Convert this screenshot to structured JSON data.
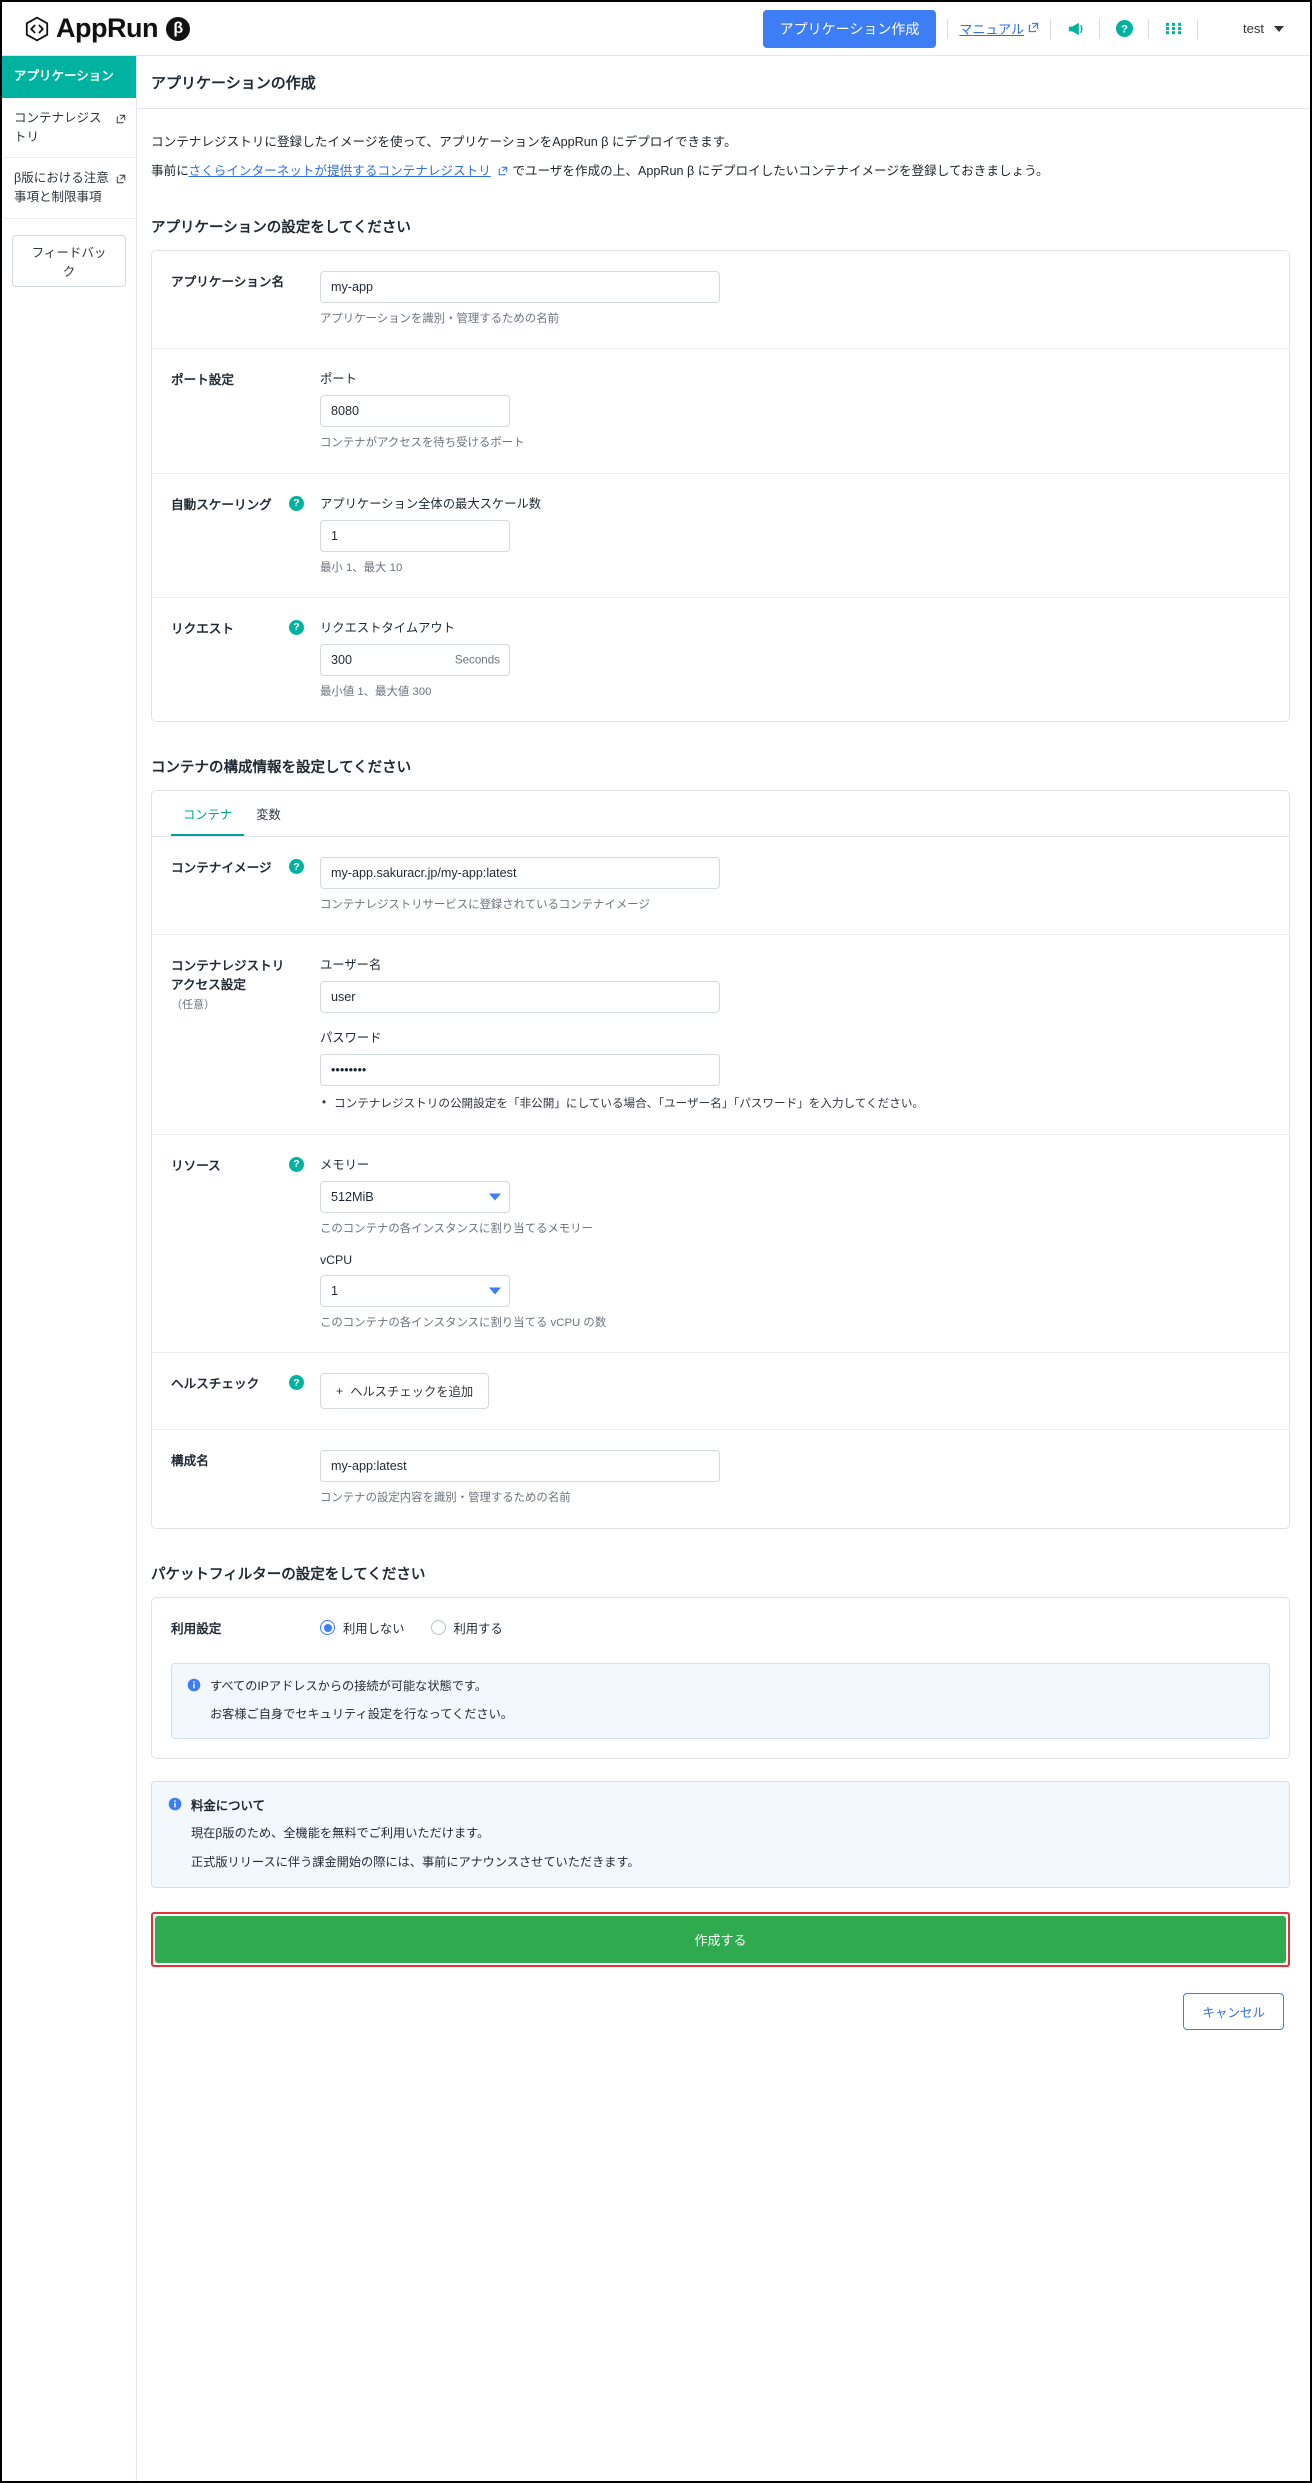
{
  "header": {
    "brand": "AppRun",
    "brand_beta": "β",
    "create_app_button": "アプリケーション作成",
    "manual_link": "マニュアル",
    "announce_icon": "megaphone-icon",
    "help_icon": "help-icon",
    "apps_icon": "grid-apps-icon",
    "user": "test"
  },
  "sidebar": {
    "items": [
      {
        "label": "アプリケーション",
        "active": true,
        "external": false
      },
      {
        "label": "コンテナレジストリ",
        "active": false,
        "external": true
      },
      {
        "label": "β版における注意事項と制限事項",
        "active": false,
        "external": true
      }
    ],
    "feedback_button": "フィードバック"
  },
  "page": {
    "title": "アプリケーションの作成",
    "intro_line1": "コンテナレジストリに登録したイメージを使って、アプリケーションをAppRun β にデプロイできます。",
    "intro_line2_pre": "事前に",
    "intro_line2_link": "さくらインターネットが提供するコンテナレジストリ",
    "intro_line2_post": "でユーザを作成の上、AppRun β にデプロイしたいコンテナイメージを登録しておきましょう。"
  },
  "app_section": {
    "heading": "アプリケーションの設定をしてください",
    "app_name": {
      "label": "アプリケーション名",
      "value": "my-app",
      "hint": "アプリケーションを識別・管理するための名前"
    },
    "port": {
      "label": "ポート設定",
      "sublabel": "ポート",
      "value": "8080",
      "hint": "コンテナがアクセスを待ち受けるポート"
    },
    "autoscale": {
      "label": "自動スケーリング",
      "sublabel": "アプリケーション全体の最大スケール数",
      "value": "1",
      "hint": "最小 1、最大 10",
      "help_icon": "help-icon"
    },
    "request": {
      "label": "リクエスト",
      "sublabel": "リクエストタイムアウト",
      "value": "300",
      "suffix": "Seconds",
      "hint": "最小値 1、最大値 300",
      "help_icon": "help-icon"
    }
  },
  "container_section": {
    "heading": "コンテナの構成情報を設定してください",
    "tabs": [
      {
        "label": "コンテナ",
        "active": true
      },
      {
        "label": "変数",
        "active": false
      }
    ],
    "image": {
      "label": "コンテナイメージ",
      "value": "my-app.sakuracr.jp/my-app:latest",
      "hint": "コンテナレジストリサービスに登録されているコンテナイメージ",
      "help_icon": "help-icon"
    },
    "registry_access": {
      "label": "コンテナレジストリアクセス設定",
      "label_optional": "（任意）",
      "username_label": "ユーザー名",
      "username_value": "user",
      "password_label": "パスワード",
      "password_value": "••••••••",
      "bullet": "コンテナレジストリの公開設定を「非公開」にしている場合、「ユーザー名」「パスワード」を入力してください。"
    },
    "resource": {
      "label": "リソース",
      "memory_label": "メモリー",
      "memory_value": "512MiB",
      "memory_hint": "このコンテナの各インスタンスに割り当てるメモリー",
      "vcpu_label": "vCPU",
      "vcpu_value": "1",
      "vcpu_hint": "このコンテナの各インスタンスに割り当てる vCPU の数",
      "help_icon": "help-icon",
      "memory_options": [
        "512MiB"
      ],
      "vcpu_options": [
        "1"
      ]
    },
    "healthcheck": {
      "label": "ヘルスチェック",
      "add_button": "ヘルスチェックを追加",
      "add_icon": "plus-icon",
      "help_icon": "help-icon"
    },
    "config_name": {
      "label": "構成名",
      "value": "my-app:latest",
      "hint": "コンテナの設定内容を識別・管理するための名前"
    }
  },
  "packet_filter": {
    "heading": "パケットフィルターの設定をしてください",
    "label": "利用設定",
    "options": [
      {
        "label": "利用しない",
        "selected": true
      },
      {
        "label": "利用する",
        "selected": false
      }
    ],
    "notice_icon": "info-icon",
    "notice_line1": "すべてのIPアドレスからの接続が可能な状態です。",
    "notice_line2": "お客様ご自身でセキュリティ設定を行なってください。"
  },
  "fee": {
    "icon": "info-icon",
    "title": "料金について",
    "line1": "現在β版のため、全機能を無料でご利用いただけます。",
    "line2": "正式版リリースに伴う課金開始の際には、事前にアナウンスさせていただきます。"
  },
  "footer": {
    "submit_button": "作成する",
    "cancel_button": "キャンセル"
  },
  "colors": {
    "brand_teal": "#00b2a0",
    "primary_blue": "#3d7df6",
    "submit_green": "#2faa4e",
    "highlight_red": "#e23434"
  }
}
